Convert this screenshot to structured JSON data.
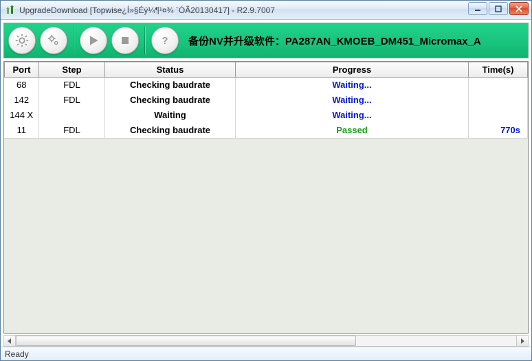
{
  "window": {
    "title": "UpgradeDownload [Topwise¿Í»§Éý¼¶¹¤¾ ¨ÓÃ20130417] - R2.9.7007"
  },
  "toolbar": {
    "info_text": "备份NV并升级软件：PA287AN_KMOEB_DM451_Micromax_A"
  },
  "columns": {
    "port": "Port",
    "step": "Step",
    "status": "Status",
    "progress": "Progress",
    "time": "Time(s)"
  },
  "rows": [
    {
      "port": "68",
      "step": "FDL",
      "status": "Checking baudrate",
      "progress": "Waiting...",
      "prog_class": "progress-waiting",
      "time": ""
    },
    {
      "port": "142",
      "step": "FDL",
      "status": "Checking baudrate",
      "progress": "Waiting...",
      "prog_class": "progress-waiting",
      "time": ""
    },
    {
      "port": "144 X",
      "step": "",
      "status": "Waiting",
      "progress": "Waiting...",
      "prog_class": "progress-waiting",
      "time": ""
    },
    {
      "port": "11",
      "step": "FDL",
      "status": "Checking baudrate",
      "progress": "Passed",
      "prog_class": "progress-passed",
      "time": "770s"
    }
  ],
  "statusbar": {
    "text": "Ready"
  }
}
